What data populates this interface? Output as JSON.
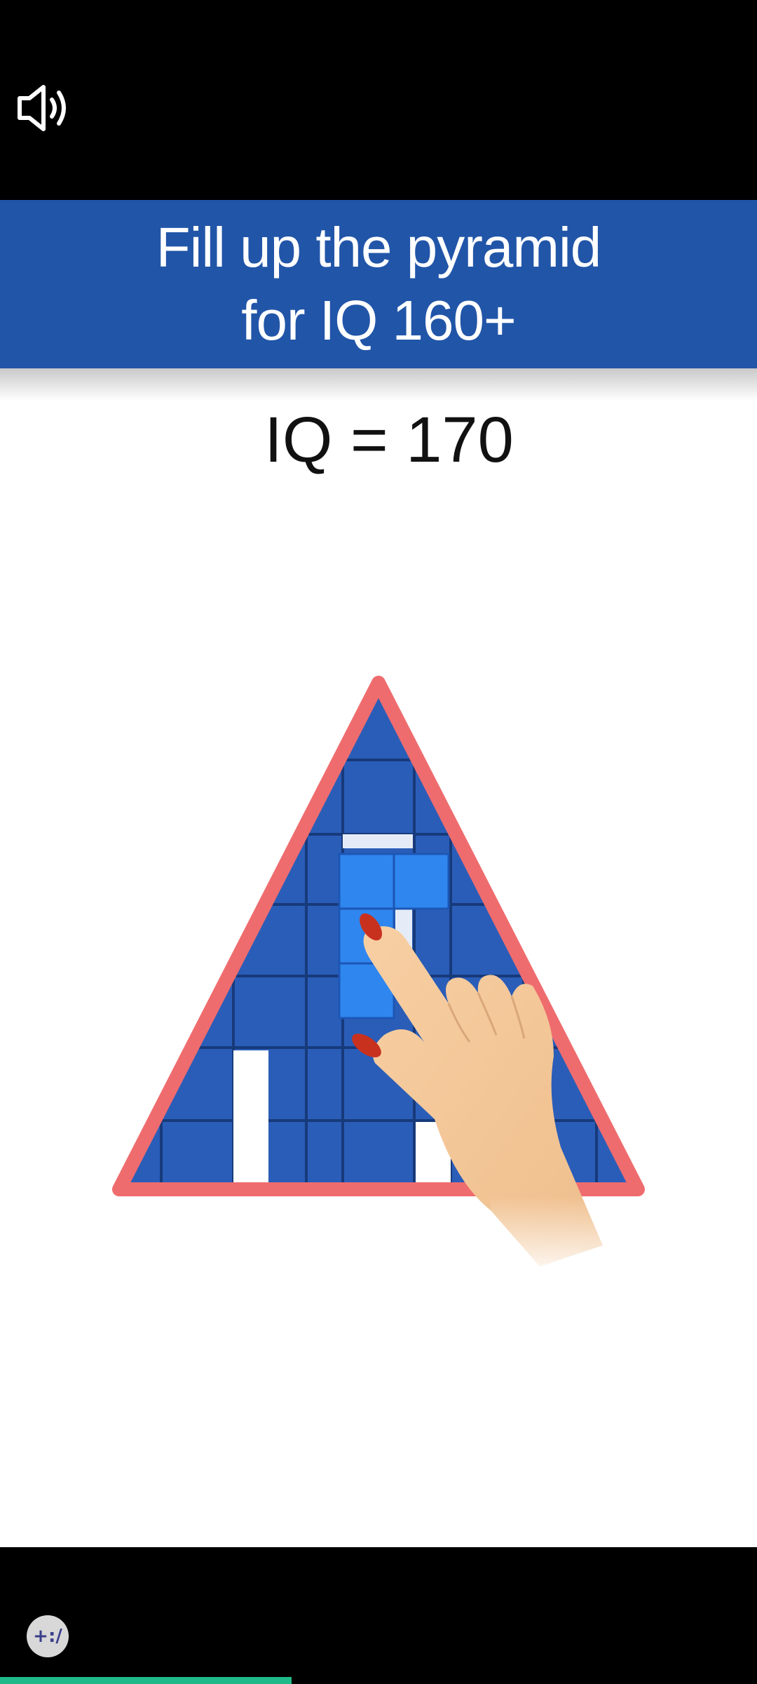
{
  "app": {
    "sound_icon": "speaker-volume-icon",
    "brand_icon": "creator-badge-icon",
    "accent_color": "#2155a8",
    "progress_color": "#1fba8a"
  },
  "banner": {
    "line1": "Fill up the pyramid",
    "line2": "for IQ 160+"
  },
  "iq_label": "IQ = 170",
  "brand_glyph": "+:/",
  "progress": {
    "fraction": 0.385
  },
  "puzzle": {
    "board_color": "#2a5db8",
    "border_color": "#ef6c6e",
    "piece_color": "#2f86ef",
    "hand_icon": "pointing-hand-icon"
  }
}
